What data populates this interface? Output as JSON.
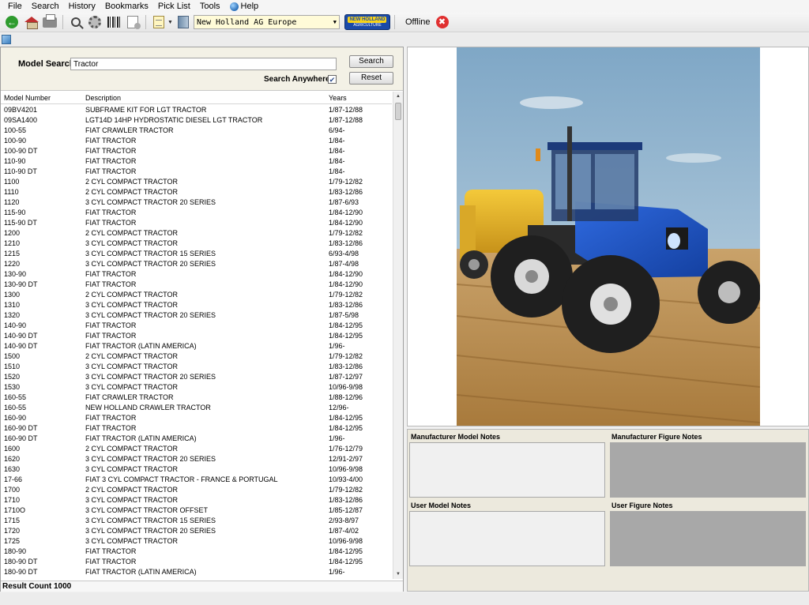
{
  "menu": {
    "items": [
      "File",
      "Search",
      "History",
      "Bookmarks",
      "Pick List",
      "Tools"
    ],
    "help": "Help"
  },
  "toolbar": {
    "catalog": "New Holland AG Europe",
    "logo_line1": "NEW HOLLAND",
    "logo_line2": "AGRICULTURE",
    "status_label": "Offline"
  },
  "search": {
    "label": "Model Search",
    "value": "Tractor",
    "search_button": "Search",
    "reset_button": "Reset",
    "anywhere_label": "Search Anywhere",
    "anywhere_checked": true
  },
  "grid": {
    "columns": [
      "Model Number",
      "Description",
      "Years"
    ],
    "rows": [
      [
        "09BV4201",
        "SUBFRAME KIT FOR LGT TRACTOR",
        "1/87-12/88"
      ],
      [
        "09SA1400",
        "LGT14D 14HP HYDROSTATIC DIESEL LGT TRACTOR",
        "1/87-12/88"
      ],
      [
        "100-55",
        "FIAT CRAWLER TRACTOR",
        "6/94-"
      ],
      [
        "100-90",
        "FIAT TRACTOR",
        "1/84-"
      ],
      [
        "100-90 DT",
        "FIAT TRACTOR",
        "1/84-"
      ],
      [
        "110-90",
        "FIAT TRACTOR",
        "1/84-"
      ],
      [
        "110-90 DT",
        "FIAT TRACTOR",
        "1/84-"
      ],
      [
        "1100",
        "2 CYL COMPACT TRACTOR",
        "1/79-12/82"
      ],
      [
        "1110",
        "2 CYL COMPACT TRACTOR",
        "1/83-12/86"
      ],
      [
        "1120",
        "3 CYL COMPACT TRACTOR 20 SERIES",
        "1/87-6/93"
      ],
      [
        "115-90",
        "FIAT TRACTOR",
        "1/84-12/90"
      ],
      [
        "115-90 DT",
        "FIAT TRACTOR",
        "1/84-12/90"
      ],
      [
        "1200",
        "2 CYL COMPACT TRACTOR",
        "1/79-12/82"
      ],
      [
        "1210",
        "3 CYL COMPACT TRACTOR",
        "1/83-12/86"
      ],
      [
        "1215",
        "3 CYL COMPACT TRACTOR 15 SERIES",
        "6/93-4/98"
      ],
      [
        "1220",
        "3 CYL COMPACT TRACTOR 20 SERIES",
        "1/87-4/98"
      ],
      [
        "130-90",
        "FIAT TRACTOR",
        "1/84-12/90"
      ],
      [
        "130-90 DT",
        "FIAT TRACTOR",
        "1/84-12/90"
      ],
      [
        "1300",
        "2 CYL COMPACT TRACTOR",
        "1/79-12/82"
      ],
      [
        "1310",
        "3 CYL COMPACT TRACTOR",
        "1/83-12/86"
      ],
      [
        "1320",
        "3 CYL COMPACT TRACTOR 20 SERIES",
        "1/87-5/98"
      ],
      [
        "140-90",
        "FIAT TRACTOR",
        "1/84-12/95"
      ],
      [
        "140-90 DT",
        "FIAT TRACTOR",
        "1/84-12/95"
      ],
      [
        "140-90 DT",
        "FIAT TRACTOR (LATIN AMERICA)",
        "1/96-"
      ],
      [
        "1500",
        "2 CYL COMPACT TRACTOR",
        "1/79-12/82"
      ],
      [
        "1510",
        "3 CYL COMPACT TRACTOR",
        "1/83-12/86"
      ],
      [
        "1520",
        "3 CYL COMPACT TRACTOR 20 SERIES",
        "1/87-12/97"
      ],
      [
        "1530",
        "3 CYL COMPACT TRACTOR",
        "10/96-9/98"
      ],
      [
        "160-55",
        "FIAT CRAWLER TRACTOR",
        "1/88-12/96"
      ],
      [
        "160-55",
        "NEW HOLLAND CRAWLER TRACTOR",
        "12/96-"
      ],
      [
        "160-90",
        "FIAT TRACTOR",
        "1/84-12/95"
      ],
      [
        "160-90 DT",
        "FIAT TRACTOR",
        "1/84-12/95"
      ],
      [
        "160-90 DT",
        "FIAT TRACTOR (LATIN AMERICA)",
        "1/96-"
      ],
      [
        "1600",
        "2 CYL COMPACT TRACTOR",
        "1/76-12/79"
      ],
      [
        "1620",
        "3 CYL COMPACT TRACTOR 20 SERIES",
        "12/91-2/97"
      ],
      [
        "1630",
        "3 CYL COMPACT TRACTOR",
        "10/96-9/98"
      ],
      [
        "17-66",
        "FIAT 3 CYL COMPACT TRACTOR - FRANCE & PORTUGAL",
        "10/93-4/00"
      ],
      [
        "1700",
        "2 CYL COMPACT TRACTOR",
        "1/79-12/82"
      ],
      [
        "1710",
        "3 CYL COMPACT TRACTOR",
        "1/83-12/86"
      ],
      [
        "1710O",
        "3 CYL COMPACT TRACTOR OFFSET",
        "1/85-12/87"
      ],
      [
        "1715",
        "3 CYL COMPACT TRACTOR 15 SERIES",
        "2/93-8/97"
      ],
      [
        "1720",
        "3 CYL COMPACT TRACTOR 20 SERIES",
        "1/87-4/02"
      ],
      [
        "1725",
        "3 CYL COMPACT TRACTOR",
        "10/96-9/98"
      ],
      [
        "180-90",
        "FIAT TRACTOR",
        "1/84-12/95"
      ],
      [
        "180-90 DT",
        "FIAT TRACTOR",
        "1/84-12/95"
      ],
      [
        "180-90 DT",
        "FIAT TRACTOR (LATIN AMERICA)",
        "1/96-"
      ]
    ]
  },
  "result_count": "Result Count  1000",
  "notes": {
    "manufacturer_model": "Manufacturer Model Notes",
    "manufacturer_figure": "Manufacturer Figure Notes",
    "user_model": "User Model Notes",
    "user_figure": "User Figure Notes"
  },
  "colors": {
    "tractor_blue": "#1c52c4",
    "baler_yellow": "#e6b21c",
    "search_panel_bg": "#f3f1e6",
    "catalog_select_bg": "#fffbd8"
  }
}
